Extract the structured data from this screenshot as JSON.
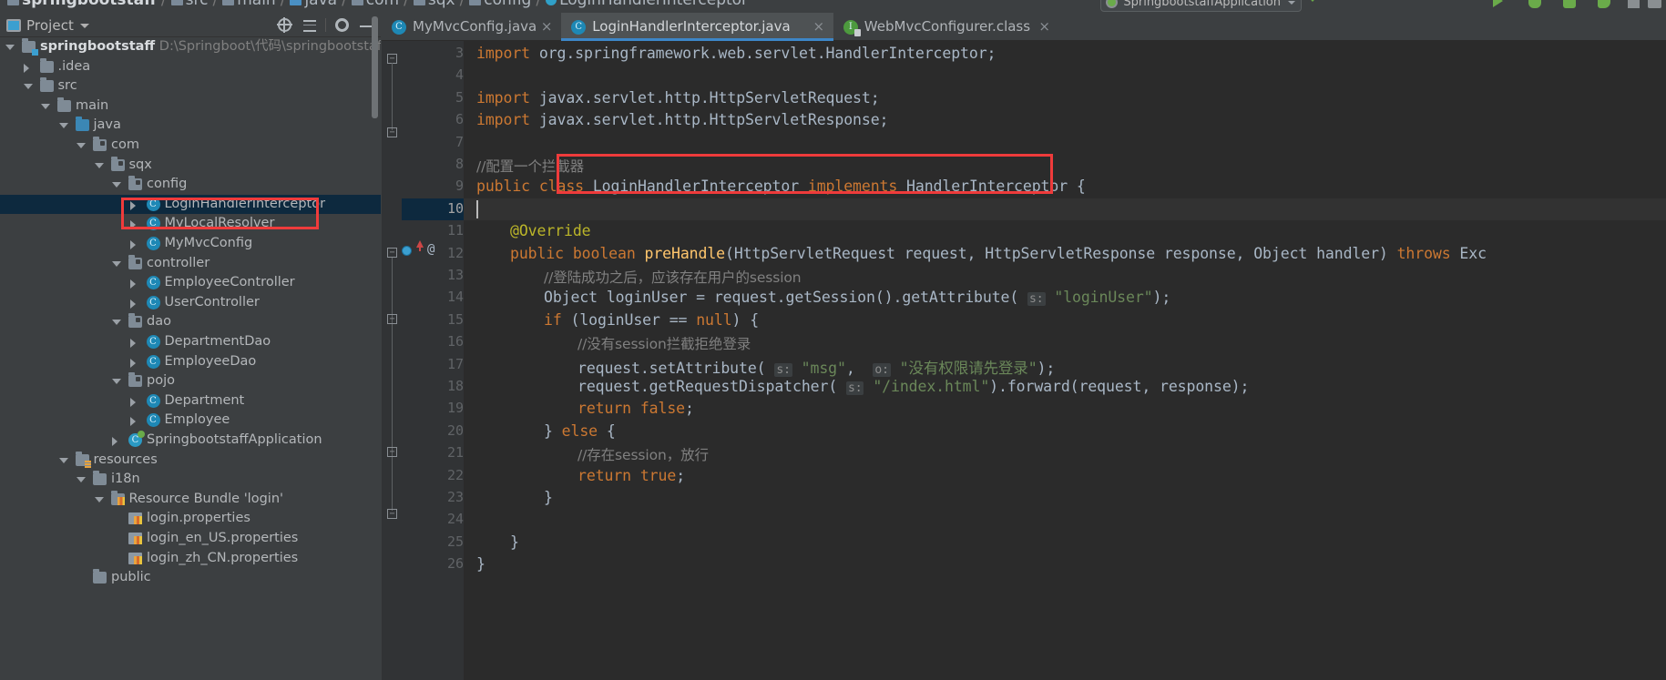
{
  "breadcrumb": {
    "items": [
      {
        "label": "springbootstaff",
        "icon": "module-icon"
      },
      {
        "label": "src",
        "icon": "folder-icon"
      },
      {
        "label": "main",
        "icon": "folder-icon"
      },
      {
        "label": "java",
        "icon": "source-folder-icon"
      },
      {
        "label": "com",
        "icon": "package-icon"
      },
      {
        "label": "sqx",
        "icon": "package-icon"
      },
      {
        "label": "config",
        "icon": "package-icon"
      },
      {
        "label": "LoginHandlerInterceptor",
        "icon": "class-icon"
      }
    ],
    "separator": "/"
  },
  "toolbar": {
    "run_configuration": "SpringbootstaffApplication",
    "run_label": "Run",
    "debug_label": "Debug",
    "stop_label": "Stop",
    "icons": [
      "run-icon",
      "debug-icon",
      "coverage-icon",
      "profile-icon",
      "stop-icon",
      "layout-icon"
    ]
  },
  "project_panel": {
    "title": "Project",
    "header_icons": [
      "locate-icon",
      "collapse-all-icon",
      "gear-icon",
      "minimize-icon"
    ],
    "tree": [
      {
        "depth": 0,
        "label": "springbootstaff",
        "path": "D:\\Springboot\\代码\\springbootstaff",
        "icon": "module-root-icon",
        "arrow": "open",
        "bold": true,
        "selected": false
      },
      {
        "depth": 1,
        "label": ".idea",
        "icon": "folder-icon",
        "arrow": "closed",
        "selected": false
      },
      {
        "depth": 1,
        "label": "src",
        "icon": "folder-icon",
        "arrow": "open",
        "selected": false
      },
      {
        "depth": 2,
        "label": "main",
        "icon": "folder-icon",
        "arrow": "open",
        "selected": false
      },
      {
        "depth": 3,
        "label": "java",
        "icon": "source-folder-icon",
        "arrow": "open",
        "selected": false
      },
      {
        "depth": 4,
        "label": "com",
        "icon": "package-icon",
        "arrow": "open",
        "selected": false
      },
      {
        "depth": 5,
        "label": "sqx",
        "icon": "package-icon",
        "arrow": "open",
        "selected": false
      },
      {
        "depth": 6,
        "label": "config",
        "icon": "package-icon",
        "arrow": "open",
        "selected": false
      },
      {
        "depth": 7,
        "label": "LoginHandlerInterceptor",
        "icon": "class-icon",
        "arrow": "closed",
        "selected": true
      },
      {
        "depth": 7,
        "label": "MyLocalResolver",
        "icon": "class-icon",
        "arrow": "closed",
        "selected": false
      },
      {
        "depth": 7,
        "label": "MyMvcConfig",
        "icon": "class-icon",
        "arrow": "closed",
        "selected": false
      },
      {
        "depth": 6,
        "label": "controller",
        "icon": "package-icon",
        "arrow": "open",
        "selected": false
      },
      {
        "depth": 7,
        "label": "EmployeeController",
        "icon": "class-icon",
        "arrow": "closed",
        "selected": false
      },
      {
        "depth": 7,
        "label": "UserController",
        "icon": "class-icon",
        "arrow": "closed",
        "selected": false
      },
      {
        "depth": 6,
        "label": "dao",
        "icon": "package-icon",
        "arrow": "open",
        "selected": false
      },
      {
        "depth": 7,
        "label": "DepartmentDao",
        "icon": "class-icon",
        "arrow": "closed",
        "selected": false
      },
      {
        "depth": 7,
        "label": "EmployeeDao",
        "icon": "class-icon",
        "arrow": "closed",
        "selected": false
      },
      {
        "depth": 6,
        "label": "pojo",
        "icon": "package-icon",
        "arrow": "open",
        "selected": false
      },
      {
        "depth": 7,
        "label": "Department",
        "icon": "class-icon",
        "arrow": "closed",
        "selected": false
      },
      {
        "depth": 7,
        "label": "Employee",
        "icon": "class-icon",
        "arrow": "closed",
        "selected": false
      },
      {
        "depth": 6,
        "label": "SpringbootstaffApplication",
        "icon": "spring-class-icon",
        "arrow": "closed",
        "selected": false
      },
      {
        "depth": 3,
        "label": "resources",
        "icon": "resources-folder-icon",
        "arrow": "open",
        "selected": false
      },
      {
        "depth": 4,
        "label": "i18n",
        "icon": "folder-icon",
        "arrow": "open",
        "selected": false
      },
      {
        "depth": 5,
        "label": "Resource Bundle 'login'",
        "icon": "resource-bundle-icon",
        "arrow": "open",
        "selected": false
      },
      {
        "depth": 6,
        "label": "login.properties",
        "icon": "properties-icon",
        "arrow": "none",
        "selected": false
      },
      {
        "depth": 6,
        "label": "login_en_US.properties",
        "icon": "properties-icon",
        "arrow": "none",
        "selected": false
      },
      {
        "depth": 6,
        "label": "login_zh_CN.properties",
        "icon": "properties-icon",
        "arrow": "none",
        "selected": false
      },
      {
        "depth": 4,
        "label": "public",
        "icon": "folder-icon",
        "arrow": "none",
        "selected": false
      }
    ]
  },
  "editor": {
    "tabs": [
      {
        "label": "MyMvcConfig.java",
        "icon": "class-icon",
        "active": false,
        "close": "×"
      },
      {
        "label": "LoginHandlerInterceptor.java",
        "icon": "class-icon",
        "active": true,
        "close": "×"
      },
      {
        "label": "WebMvcConfigurer.class",
        "icon": "interface-icon",
        "active": false,
        "close": "×"
      }
    ],
    "current_line": 10,
    "lines": [
      {
        "n": 3,
        "indent": 0,
        "tokens": [
          {
            "t": "import ",
            "c": "kw"
          },
          {
            "t": "org.springframework.web.servlet.HandlerInterceptor;",
            "c": ""
          }
        ]
      },
      {
        "n": 4,
        "indent": 0,
        "tokens": []
      },
      {
        "n": 5,
        "indent": 0,
        "tokens": [
          {
            "t": "import ",
            "c": "kw"
          },
          {
            "t": "javax.servlet.http.HttpServletRequest;",
            "c": ""
          }
        ]
      },
      {
        "n": 6,
        "indent": 0,
        "tokens": [
          {
            "t": "import ",
            "c": "kw"
          },
          {
            "t": "javax.servlet.http.HttpServletResponse;",
            "c": ""
          }
        ]
      },
      {
        "n": 7,
        "indent": 0,
        "tokens": []
      },
      {
        "n": 8,
        "indent": 0,
        "tokens": [
          {
            "t": "//配置一个拦截器",
            "c": "cmt"
          }
        ]
      },
      {
        "n": 9,
        "indent": 0,
        "tokens": [
          {
            "t": "public class ",
            "c": "kw"
          },
          {
            "t": "LoginHandlerInterceptor ",
            "c": ""
          },
          {
            "t": "implements ",
            "c": "kw"
          },
          {
            "t": "HandlerInterceptor {",
            "c": ""
          }
        ]
      },
      {
        "n": 10,
        "indent": 0,
        "tokens": []
      },
      {
        "n": 11,
        "indent": 1,
        "tokens": [
          {
            "t": "@Override",
            "c": "ann"
          }
        ]
      },
      {
        "n": 12,
        "indent": 1,
        "tokens": [
          {
            "t": "public boolean ",
            "c": "kw"
          },
          {
            "t": "preHandle",
            "c": "mth"
          },
          {
            "t": "(HttpServletRequest request, HttpServletResponse response, Object handler) ",
            "c": ""
          },
          {
            "t": "throws ",
            "c": "kw"
          },
          {
            "t": "Exc",
            "c": ""
          }
        ]
      },
      {
        "n": 13,
        "indent": 2,
        "tokens": [
          {
            "t": "//登陆成功之后，应该存在用户的session",
            "c": "cmt"
          }
        ]
      },
      {
        "n": 14,
        "indent": 2,
        "tokens": [
          {
            "t": "Object loginUser = request.getSession().getAttribute( ",
            "c": ""
          },
          {
            "t": "s:",
            "c": "hint"
          },
          {
            "t": " ",
            "c": ""
          },
          {
            "t": "\"loginUser\"",
            "c": "str"
          },
          {
            "t": ");",
            "c": ""
          }
        ]
      },
      {
        "n": 15,
        "indent": 2,
        "tokens": [
          {
            "t": "if ",
            "c": "kw"
          },
          {
            "t": "(loginUser == ",
            "c": ""
          },
          {
            "t": "null",
            "c": "kw"
          },
          {
            "t": ") {",
            "c": ""
          }
        ]
      },
      {
        "n": 16,
        "indent": 3,
        "tokens": [
          {
            "t": "//没有session拦截拒绝登录",
            "c": "cmt"
          }
        ]
      },
      {
        "n": 17,
        "indent": 3,
        "tokens": [
          {
            "t": "request.setAttribute( ",
            "c": ""
          },
          {
            "t": "s:",
            "c": "hint"
          },
          {
            "t": " ",
            "c": ""
          },
          {
            "t": "\"msg\"",
            "c": "str"
          },
          {
            "t": ",  ",
            "c": ""
          },
          {
            "t": "o:",
            "c": "hint"
          },
          {
            "t": " ",
            "c": ""
          },
          {
            "t": "\"没有权限请先登录\"",
            "c": "str"
          },
          {
            "t": ");",
            "c": ""
          }
        ]
      },
      {
        "n": 18,
        "indent": 3,
        "tokens": [
          {
            "t": "request.getRequestDispatcher( ",
            "c": ""
          },
          {
            "t": "s:",
            "c": "hint"
          },
          {
            "t": " ",
            "c": ""
          },
          {
            "t": "\"/index.html\"",
            "c": "str"
          },
          {
            "t": ").forward(request, response);",
            "c": ""
          }
        ]
      },
      {
        "n": 19,
        "indent": 3,
        "tokens": [
          {
            "t": "return false",
            "c": "kw"
          },
          {
            "t": ";",
            "c": ""
          }
        ]
      },
      {
        "n": 20,
        "indent": 2,
        "tokens": [
          {
            "t": "} ",
            "c": ""
          },
          {
            "t": "else ",
            "c": "kw"
          },
          {
            "t": "{",
            "c": ""
          }
        ]
      },
      {
        "n": 21,
        "indent": 3,
        "tokens": [
          {
            "t": "//存在session，放行",
            "c": "cmt"
          }
        ]
      },
      {
        "n": 22,
        "indent": 3,
        "tokens": [
          {
            "t": "return true",
            "c": "kw"
          },
          {
            "t": ";",
            "c": ""
          }
        ]
      },
      {
        "n": 23,
        "indent": 2,
        "tokens": [
          {
            "t": "}",
            "c": ""
          }
        ]
      },
      {
        "n": 24,
        "indent": 0,
        "tokens": []
      },
      {
        "n": 25,
        "indent": 1,
        "tokens": [
          {
            "t": "}",
            "c": ""
          }
        ]
      },
      {
        "n": 26,
        "indent": 0,
        "tokens": [
          {
            "t": "}",
            "c": ""
          }
        ]
      }
    ]
  },
  "annotations": {
    "highlight_color": "#ef3b3b",
    "tree_highlight_target": "LoginHandlerInterceptor",
    "code_highlight_target": "public class LoginHandlerInterceptor implements HandlerInterceptor {"
  }
}
